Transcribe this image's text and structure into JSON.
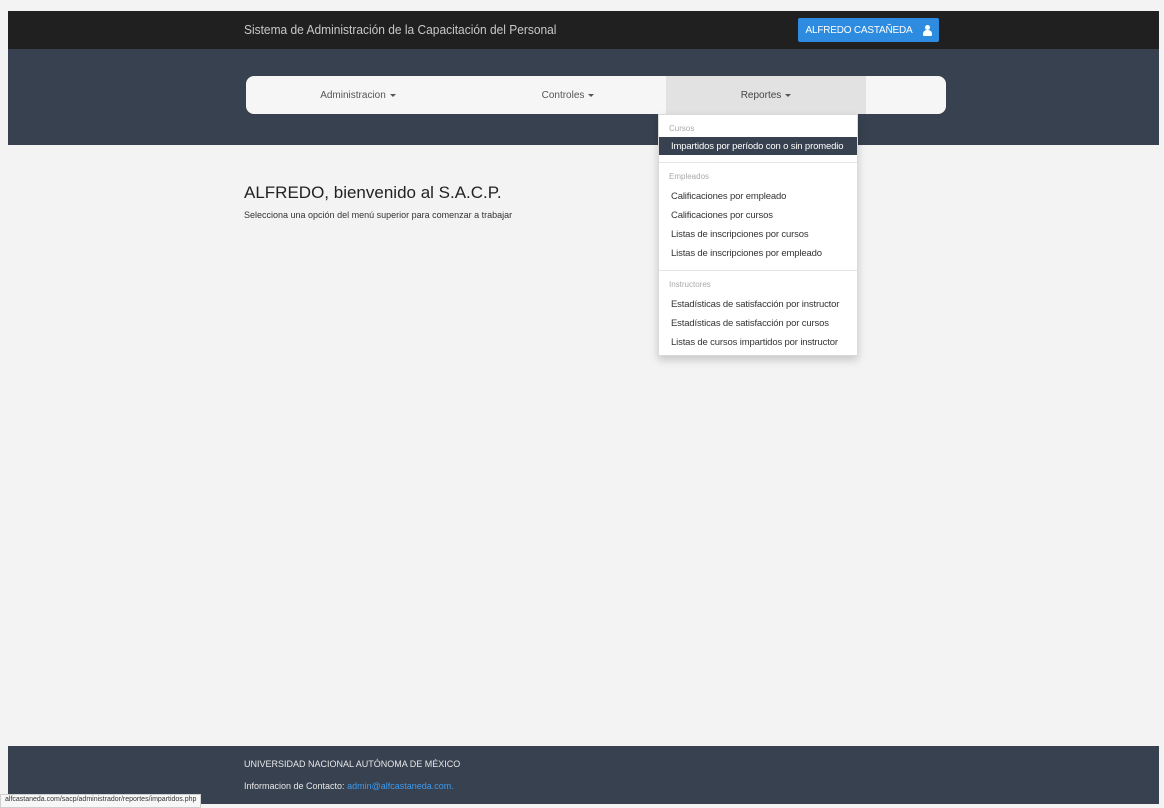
{
  "header": {
    "system_title": "Sistema de Administración de la Capacitación del Personal",
    "user_button": "ALFREDO CASTAÑEDA",
    "user_icon": "user-icon"
  },
  "nav": {
    "items": [
      {
        "label": "Administracion"
      },
      {
        "label": "Controles"
      },
      {
        "label": "Reportes"
      }
    ]
  },
  "dropdown": {
    "sections": [
      {
        "header": "Cursos",
        "items": [
          "Impartidos por período con o sin promedio"
        ]
      },
      {
        "header": "Empleados",
        "items": [
          "Calificaciones por empleado",
          "Calificaciones por cursos",
          "Listas de inscripciones por cursos",
          "Listas de inscripciones por empleado"
        ]
      },
      {
        "header": "Instructores",
        "items": [
          "Estadísticas de satisfacción por instructor",
          "Estadísticas de satisfacción por cursos",
          "Listas de cursos impartidos por instructor"
        ]
      }
    ]
  },
  "main": {
    "welcome_title": "ALFREDO, bienvenido al S.A.C.P.",
    "welcome_subtitle": "Selecciona una opción del menú superior para comenzar a trabajar"
  },
  "footer": {
    "university": "UNIVERSIDAD NACIONAL AUTÓNOMA DE MÉXICO",
    "contact_label": "Informacion de Contacto:",
    "contact_email": "admin@alfcastaneda.com."
  },
  "status_bar": {
    "url": "alfcastaneda.com/sacp/administrador/reportes/impartidos.php"
  },
  "colors": {
    "topbar": "#202020",
    "navband": "#37414f",
    "accent": "#2e8ce0",
    "link": "#3d9bf0"
  }
}
